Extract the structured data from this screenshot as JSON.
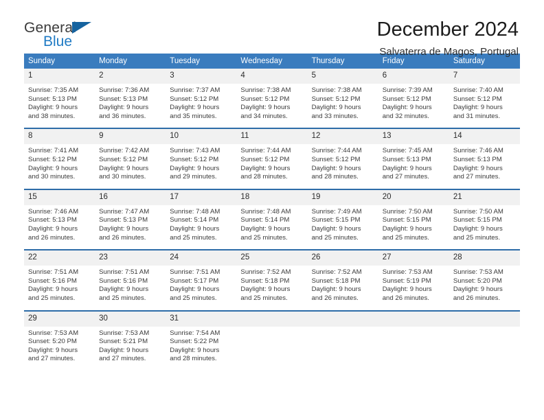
{
  "brand": {
    "line1": "General",
    "line2": "Blue",
    "triangle_color": "#16639f",
    "blue_color": "#1f7ac4"
  },
  "header": {
    "title": "December 2024",
    "subtitle": "Salvaterra de Magos, Portugal",
    "accent_color": "#3a7cbe",
    "week_divider_color": "#2d6ca8",
    "daynum_bg": "#f1f1f1"
  },
  "weekdays": [
    "Sunday",
    "Monday",
    "Tuesday",
    "Wednesday",
    "Thursday",
    "Friday",
    "Saturday"
  ],
  "weeks": [
    [
      {
        "day": "1",
        "sunrise": "Sunrise: 7:35 AM",
        "sunset": "Sunset: 5:13 PM",
        "daylight1": "Daylight: 9 hours",
        "daylight2": "and 38 minutes."
      },
      {
        "day": "2",
        "sunrise": "Sunrise: 7:36 AM",
        "sunset": "Sunset: 5:13 PM",
        "daylight1": "Daylight: 9 hours",
        "daylight2": "and 36 minutes."
      },
      {
        "day": "3",
        "sunrise": "Sunrise: 7:37 AM",
        "sunset": "Sunset: 5:12 PM",
        "daylight1": "Daylight: 9 hours",
        "daylight2": "and 35 minutes."
      },
      {
        "day": "4",
        "sunrise": "Sunrise: 7:38 AM",
        "sunset": "Sunset: 5:12 PM",
        "daylight1": "Daylight: 9 hours",
        "daylight2": "and 34 minutes."
      },
      {
        "day": "5",
        "sunrise": "Sunrise: 7:38 AM",
        "sunset": "Sunset: 5:12 PM",
        "daylight1": "Daylight: 9 hours",
        "daylight2": "and 33 minutes."
      },
      {
        "day": "6",
        "sunrise": "Sunrise: 7:39 AM",
        "sunset": "Sunset: 5:12 PM",
        "daylight1": "Daylight: 9 hours",
        "daylight2": "and 32 minutes."
      },
      {
        "day": "7",
        "sunrise": "Sunrise: 7:40 AM",
        "sunset": "Sunset: 5:12 PM",
        "daylight1": "Daylight: 9 hours",
        "daylight2": "and 31 minutes."
      }
    ],
    [
      {
        "day": "8",
        "sunrise": "Sunrise: 7:41 AM",
        "sunset": "Sunset: 5:12 PM",
        "daylight1": "Daylight: 9 hours",
        "daylight2": "and 30 minutes."
      },
      {
        "day": "9",
        "sunrise": "Sunrise: 7:42 AM",
        "sunset": "Sunset: 5:12 PM",
        "daylight1": "Daylight: 9 hours",
        "daylight2": "and 30 minutes."
      },
      {
        "day": "10",
        "sunrise": "Sunrise: 7:43 AM",
        "sunset": "Sunset: 5:12 PM",
        "daylight1": "Daylight: 9 hours",
        "daylight2": "and 29 minutes."
      },
      {
        "day": "11",
        "sunrise": "Sunrise: 7:44 AM",
        "sunset": "Sunset: 5:12 PM",
        "daylight1": "Daylight: 9 hours",
        "daylight2": "and 28 minutes."
      },
      {
        "day": "12",
        "sunrise": "Sunrise: 7:44 AM",
        "sunset": "Sunset: 5:12 PM",
        "daylight1": "Daylight: 9 hours",
        "daylight2": "and 28 minutes."
      },
      {
        "day": "13",
        "sunrise": "Sunrise: 7:45 AM",
        "sunset": "Sunset: 5:13 PM",
        "daylight1": "Daylight: 9 hours",
        "daylight2": "and 27 minutes."
      },
      {
        "day": "14",
        "sunrise": "Sunrise: 7:46 AM",
        "sunset": "Sunset: 5:13 PM",
        "daylight1": "Daylight: 9 hours",
        "daylight2": "and 27 minutes."
      }
    ],
    [
      {
        "day": "15",
        "sunrise": "Sunrise: 7:46 AM",
        "sunset": "Sunset: 5:13 PM",
        "daylight1": "Daylight: 9 hours",
        "daylight2": "and 26 minutes."
      },
      {
        "day": "16",
        "sunrise": "Sunrise: 7:47 AM",
        "sunset": "Sunset: 5:13 PM",
        "daylight1": "Daylight: 9 hours",
        "daylight2": "and 26 minutes."
      },
      {
        "day": "17",
        "sunrise": "Sunrise: 7:48 AM",
        "sunset": "Sunset: 5:14 PM",
        "daylight1": "Daylight: 9 hours",
        "daylight2": "and 25 minutes."
      },
      {
        "day": "18",
        "sunrise": "Sunrise: 7:48 AM",
        "sunset": "Sunset: 5:14 PM",
        "daylight1": "Daylight: 9 hours",
        "daylight2": "and 25 minutes."
      },
      {
        "day": "19",
        "sunrise": "Sunrise: 7:49 AM",
        "sunset": "Sunset: 5:15 PM",
        "daylight1": "Daylight: 9 hours",
        "daylight2": "and 25 minutes."
      },
      {
        "day": "20",
        "sunrise": "Sunrise: 7:50 AM",
        "sunset": "Sunset: 5:15 PM",
        "daylight1": "Daylight: 9 hours",
        "daylight2": "and 25 minutes."
      },
      {
        "day": "21",
        "sunrise": "Sunrise: 7:50 AM",
        "sunset": "Sunset: 5:15 PM",
        "daylight1": "Daylight: 9 hours",
        "daylight2": "and 25 minutes."
      }
    ],
    [
      {
        "day": "22",
        "sunrise": "Sunrise: 7:51 AM",
        "sunset": "Sunset: 5:16 PM",
        "daylight1": "Daylight: 9 hours",
        "daylight2": "and 25 minutes."
      },
      {
        "day": "23",
        "sunrise": "Sunrise: 7:51 AM",
        "sunset": "Sunset: 5:16 PM",
        "daylight1": "Daylight: 9 hours",
        "daylight2": "and 25 minutes."
      },
      {
        "day": "24",
        "sunrise": "Sunrise: 7:51 AM",
        "sunset": "Sunset: 5:17 PM",
        "daylight1": "Daylight: 9 hours",
        "daylight2": "and 25 minutes."
      },
      {
        "day": "25",
        "sunrise": "Sunrise: 7:52 AM",
        "sunset": "Sunset: 5:18 PM",
        "daylight1": "Daylight: 9 hours",
        "daylight2": "and 25 minutes."
      },
      {
        "day": "26",
        "sunrise": "Sunrise: 7:52 AM",
        "sunset": "Sunset: 5:18 PM",
        "daylight1": "Daylight: 9 hours",
        "daylight2": "and 26 minutes."
      },
      {
        "day": "27",
        "sunrise": "Sunrise: 7:53 AM",
        "sunset": "Sunset: 5:19 PM",
        "daylight1": "Daylight: 9 hours",
        "daylight2": "and 26 minutes."
      },
      {
        "day": "28",
        "sunrise": "Sunrise: 7:53 AM",
        "sunset": "Sunset: 5:20 PM",
        "daylight1": "Daylight: 9 hours",
        "daylight2": "and 26 minutes."
      }
    ],
    [
      {
        "day": "29",
        "sunrise": "Sunrise: 7:53 AM",
        "sunset": "Sunset: 5:20 PM",
        "daylight1": "Daylight: 9 hours",
        "daylight2": "and 27 minutes."
      },
      {
        "day": "30",
        "sunrise": "Sunrise: 7:53 AM",
        "sunset": "Sunset: 5:21 PM",
        "daylight1": "Daylight: 9 hours",
        "daylight2": "and 27 minutes."
      },
      {
        "day": "31",
        "sunrise": "Sunrise: 7:54 AM",
        "sunset": "Sunset: 5:22 PM",
        "daylight1": "Daylight: 9 hours",
        "daylight2": "and 28 minutes."
      },
      {
        "day": "",
        "sunrise": "",
        "sunset": "",
        "daylight1": "",
        "daylight2": ""
      },
      {
        "day": "",
        "sunrise": "",
        "sunset": "",
        "daylight1": "",
        "daylight2": ""
      },
      {
        "day": "",
        "sunrise": "",
        "sunset": "",
        "daylight1": "",
        "daylight2": ""
      },
      {
        "day": "",
        "sunrise": "",
        "sunset": "",
        "daylight1": "",
        "daylight2": ""
      }
    ]
  ]
}
